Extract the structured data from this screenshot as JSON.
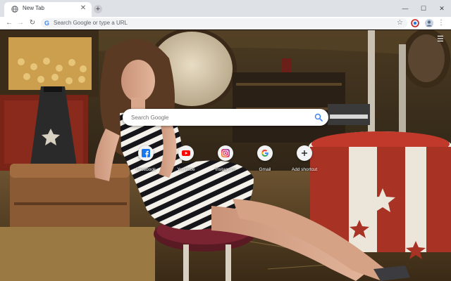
{
  "browser": {
    "tab_title": "New Tab",
    "tab_close_icon": "close-icon",
    "new_tab_symbol": "+",
    "omnibox_placeholder": "Search Google or type a URL"
  },
  "ntp": {
    "search_placeholder": "Search Google",
    "shortcuts": [
      {
        "label": "Facebook",
        "icon": "facebook-icon",
        "color": "#1877f2"
      },
      {
        "label": "YouTube",
        "icon": "youtube-icon",
        "color": "#ff0000"
      },
      {
        "label": "Instagram",
        "icon": "instagram-icon",
        "color": "#c13584"
      },
      {
        "label": "Gmail",
        "icon": "google-icon",
        "color": "#4285f4"
      },
      {
        "label": "Add shortcut",
        "icon": "plus-icon",
        "color": "#202124"
      }
    ]
  },
  "colors": {
    "tabstrip": "#dee1e6",
    "toolbar": "#ffffff",
    "omnibox": "#f1f3f4",
    "search_icon": "#4285f4"
  }
}
